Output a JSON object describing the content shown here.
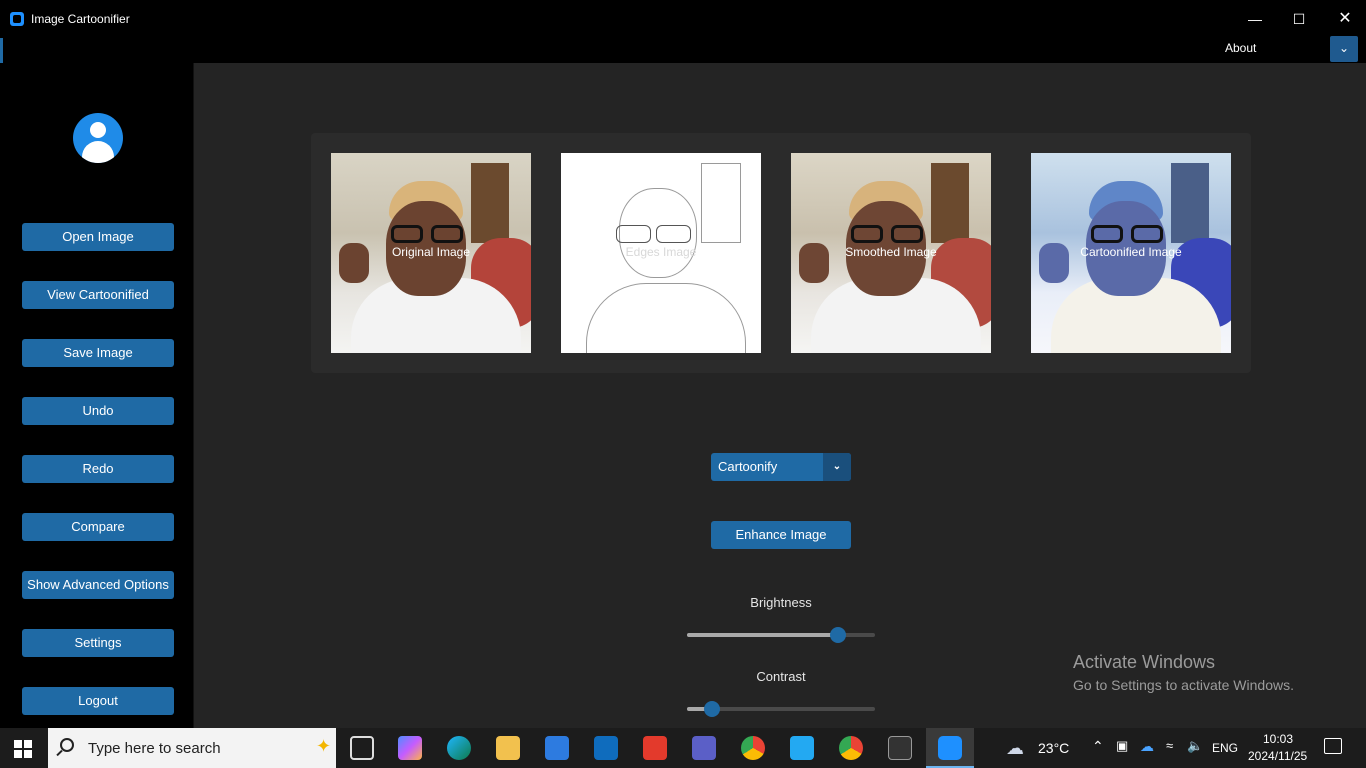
{
  "window": {
    "title": "Image Cartoonifier",
    "menu": {
      "about": "About"
    },
    "controls": {
      "minimize": "—",
      "maximize": "☐",
      "close": "✕"
    }
  },
  "sidebar": {
    "buttons": [
      {
        "label": "Open Image"
      },
      {
        "label": "View Cartoonified"
      },
      {
        "label": "Save Image"
      },
      {
        "label": "Undo"
      },
      {
        "label": "Redo"
      },
      {
        "label": "Compare"
      },
      {
        "label": "Show Advanced Options"
      },
      {
        "label": "Settings"
      },
      {
        "label": "Logout"
      }
    ]
  },
  "images": {
    "original": "Original Image",
    "edges": "Edges Image",
    "smoothed": "Smoothed Image",
    "cartoonified": "Cartoonified Image"
  },
  "controls": {
    "mode_select": {
      "value": "Cartoonify"
    },
    "enhance_button": "Enhance Image",
    "brightness": {
      "label": "Brightness",
      "value": 0.83
    },
    "contrast": {
      "label": "Contrast",
      "value": 0.1
    }
  },
  "watermark": {
    "line1": "Activate Windows",
    "line2": "Go to Settings to activate Windows."
  },
  "taskbar": {
    "search_placeholder": "Type here to search",
    "weather": "23°C",
    "language": "ENG",
    "time": "10:03",
    "date": "2024/11/25"
  },
  "colors": {
    "accent": "#1f6aa5",
    "main_bg": "#242424",
    "sidebar_bg": "#000000",
    "panel_bg": "#2b2b2b"
  }
}
